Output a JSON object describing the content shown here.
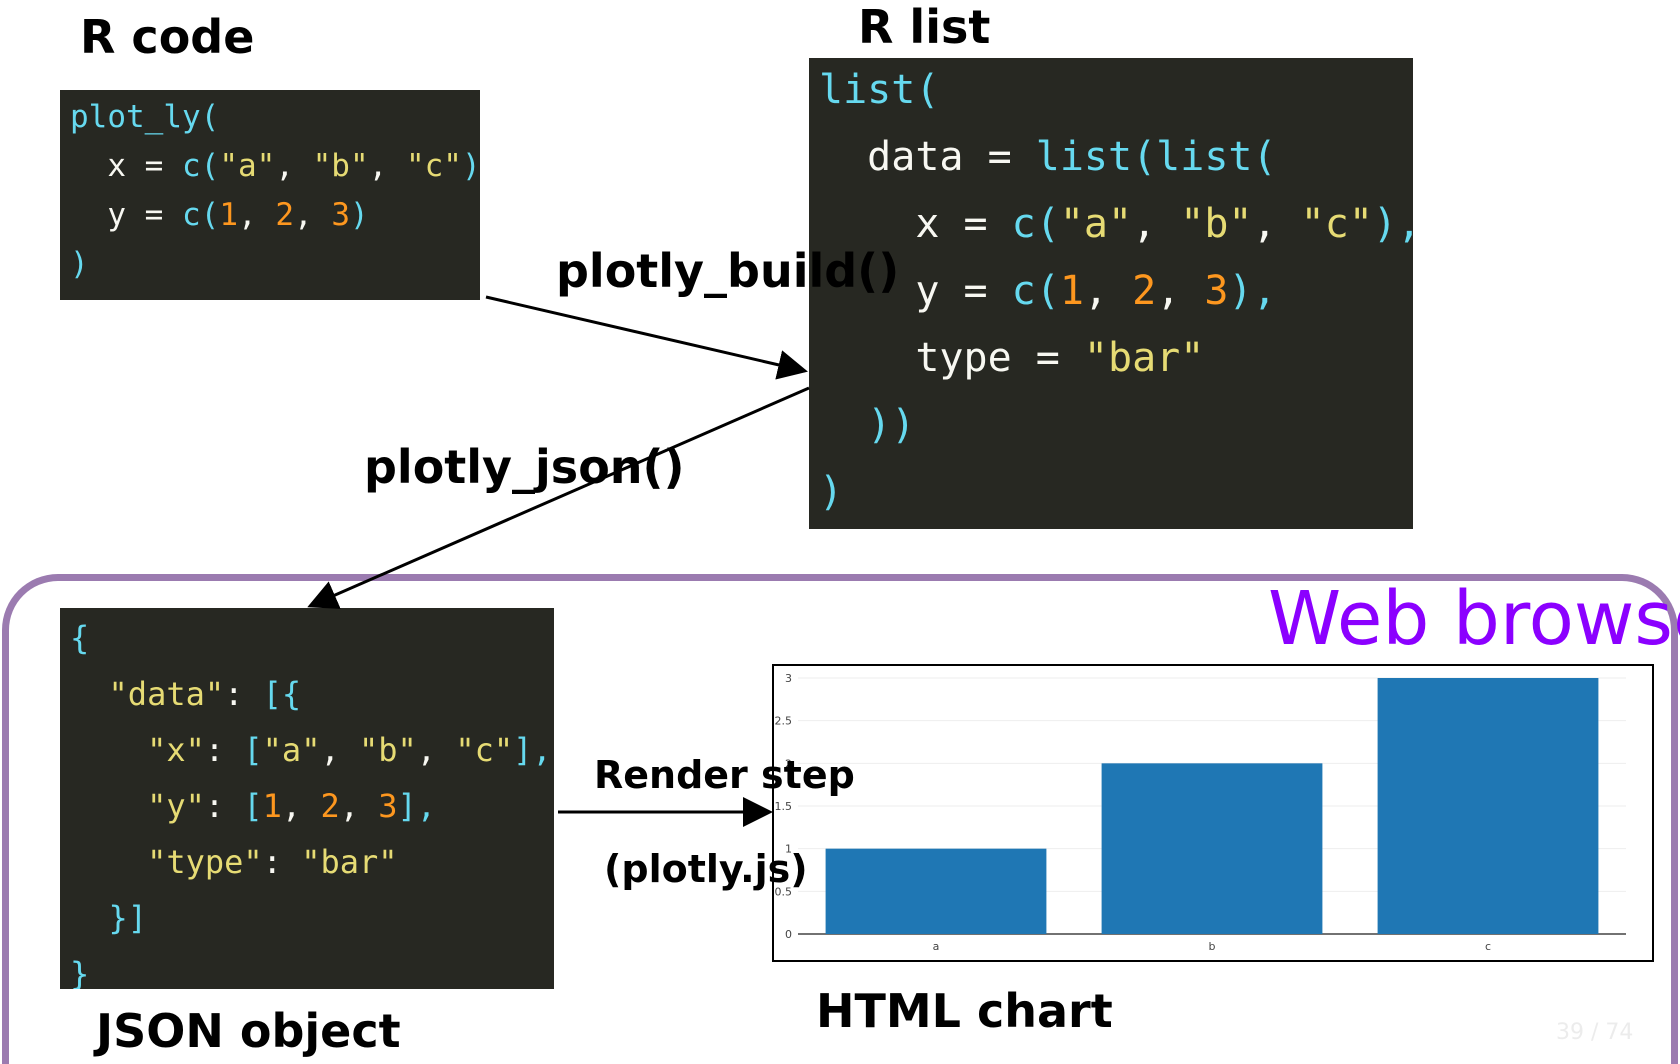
{
  "headings": {
    "r_code": "R code",
    "r_list": "R list",
    "json_object": "JSON object",
    "html_chart": "HTML chart"
  },
  "steps": {
    "plotly_build": "plotly_build()",
    "plotly_json": "plotly_json()",
    "render_step": "Render step",
    "render_lib": "(plotly.js)"
  },
  "browser_label": "Web browser",
  "page_number": "39 / 74",
  "code": {
    "r_code": [
      [
        {
          "t": "plot_ly(",
          "c": "p"
        }
      ],
      [
        {
          "t": "  x = ",
          "c": "t"
        },
        {
          "t": "c(",
          "c": "p"
        },
        {
          "t": "\"a\"",
          "c": "s"
        },
        {
          "t": ", ",
          "c": "o"
        },
        {
          "t": "\"b\"",
          "c": "s"
        },
        {
          "t": ", ",
          "c": "o"
        },
        {
          "t": "\"c\"",
          "c": "s"
        },
        {
          "t": "),",
          "c": "p"
        }
      ],
      [
        {
          "t": "  y = ",
          "c": "t"
        },
        {
          "t": "c(",
          "c": "p"
        },
        {
          "t": "1",
          "c": "n"
        },
        {
          "t": ", ",
          "c": "o"
        },
        {
          "t": "2",
          "c": "n"
        },
        {
          "t": ", ",
          "c": "o"
        },
        {
          "t": "3",
          "c": "n"
        },
        {
          "t": ")",
          "c": "p"
        }
      ],
      [
        {
          "t": ")",
          "c": "p"
        }
      ]
    ],
    "r_list": [
      [
        {
          "t": "list(",
          "c": "p"
        }
      ],
      [
        {
          "t": "  data = ",
          "c": "t"
        },
        {
          "t": "list(list(",
          "c": "p"
        }
      ],
      [
        {
          "t": "    x = ",
          "c": "t"
        },
        {
          "t": "c(",
          "c": "p"
        },
        {
          "t": "\"a\"",
          "c": "s"
        },
        {
          "t": ", ",
          "c": "o"
        },
        {
          "t": "\"b\"",
          "c": "s"
        },
        {
          "t": ", ",
          "c": "o"
        },
        {
          "t": "\"c\"",
          "c": "s"
        },
        {
          "t": "),",
          "c": "p"
        }
      ],
      [
        {
          "t": "    y = ",
          "c": "t"
        },
        {
          "t": "c(",
          "c": "p"
        },
        {
          "t": "1",
          "c": "n"
        },
        {
          "t": ", ",
          "c": "o"
        },
        {
          "t": "2",
          "c": "n"
        },
        {
          "t": ", ",
          "c": "o"
        },
        {
          "t": "3",
          "c": "n"
        },
        {
          "t": "),",
          "c": "p"
        }
      ],
      [
        {
          "t": "    type = ",
          "c": "t"
        },
        {
          "t": "\"bar\"",
          "c": "s"
        }
      ],
      [
        {
          "t": "  ))",
          "c": "p"
        }
      ],
      [
        {
          "t": ")",
          "c": "p"
        }
      ]
    ],
    "json_object": [
      [
        {
          "t": "{",
          "c": "p"
        }
      ],
      [
        {
          "t": "  \"data\"",
          "c": "s"
        },
        {
          "t": ": ",
          "c": "o"
        },
        {
          "t": "[{",
          "c": "p"
        }
      ],
      [
        {
          "t": "    \"x\"",
          "c": "s"
        },
        {
          "t": ": ",
          "c": "o"
        },
        {
          "t": "[",
          "c": "p"
        },
        {
          "t": "\"a\"",
          "c": "s"
        },
        {
          "t": ", ",
          "c": "o"
        },
        {
          "t": "\"b\"",
          "c": "s"
        },
        {
          "t": ", ",
          "c": "o"
        },
        {
          "t": "\"c\"",
          "c": "s"
        },
        {
          "t": "],",
          "c": "p"
        }
      ],
      [
        {
          "t": "    \"y\"",
          "c": "s"
        },
        {
          "t": ": ",
          "c": "o"
        },
        {
          "t": "[",
          "c": "p"
        },
        {
          "t": "1",
          "c": "n"
        },
        {
          "t": ", ",
          "c": "o"
        },
        {
          "t": "2",
          "c": "n"
        },
        {
          "t": ", ",
          "c": "o"
        },
        {
          "t": "3",
          "c": "n"
        },
        {
          "t": "],",
          "c": "p"
        }
      ],
      [
        {
          "t": "    \"type\"",
          "c": "s"
        },
        {
          "t": ": ",
          "c": "o"
        },
        {
          "t": "\"bar\"",
          "c": "s"
        }
      ],
      [
        {
          "t": "  }]",
          "c": "p"
        }
      ],
      [
        {
          "t": "}",
          "c": "p"
        }
      ]
    ]
  },
  "chart_data": {
    "type": "bar",
    "categories": [
      "a",
      "b",
      "c"
    ],
    "values": [
      1,
      2,
      3
    ],
    "y_ticks": [
      0,
      0.5,
      1,
      1.5,
      2,
      2.5,
      3
    ],
    "ylim": [
      0,
      3
    ],
    "bar_color": "#1f77b4",
    "grid": true
  },
  "colors": {
    "code_bg": "#272822",
    "browser_frame": "#9b7bb0",
    "browser_label": "#8b00ff",
    "bar": "#1f77b4"
  }
}
